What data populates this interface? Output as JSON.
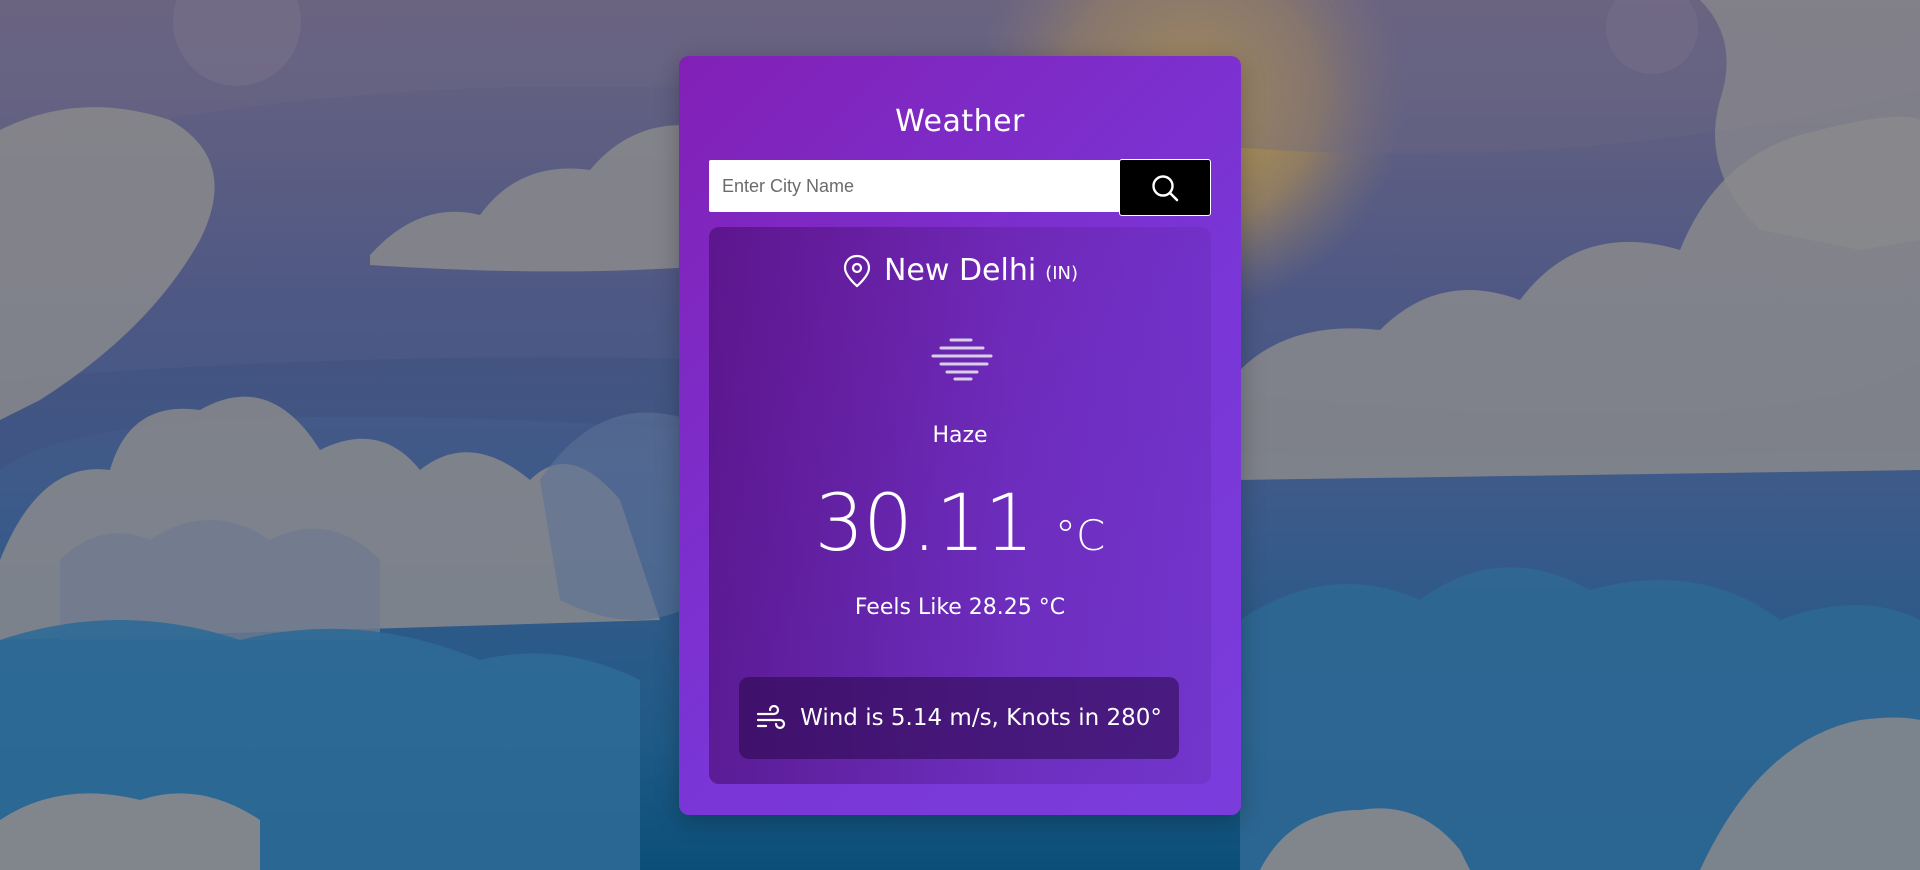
{
  "app": {
    "title": "Weather"
  },
  "search": {
    "placeholder": "Enter City Name",
    "value": "",
    "button_icon": "search-icon"
  },
  "location": {
    "icon": "map-pin-icon",
    "city": "New Delhi",
    "country": "(IN)"
  },
  "weather": {
    "icon": "haze-icon",
    "condition": "Haze",
    "temperature": "30.11",
    "unit": "°C",
    "feels_like": "Feels Like 28.25 °C"
  },
  "wind": {
    "icon": "wind-icon",
    "text": "Wind is 5.14 m/s, Knots in 280°"
  },
  "colors": {
    "card_gradient_start": "#8220b6",
    "card_gradient_end": "#7a3ddc",
    "search_button": "#000000",
    "text": "#ffffff"
  }
}
